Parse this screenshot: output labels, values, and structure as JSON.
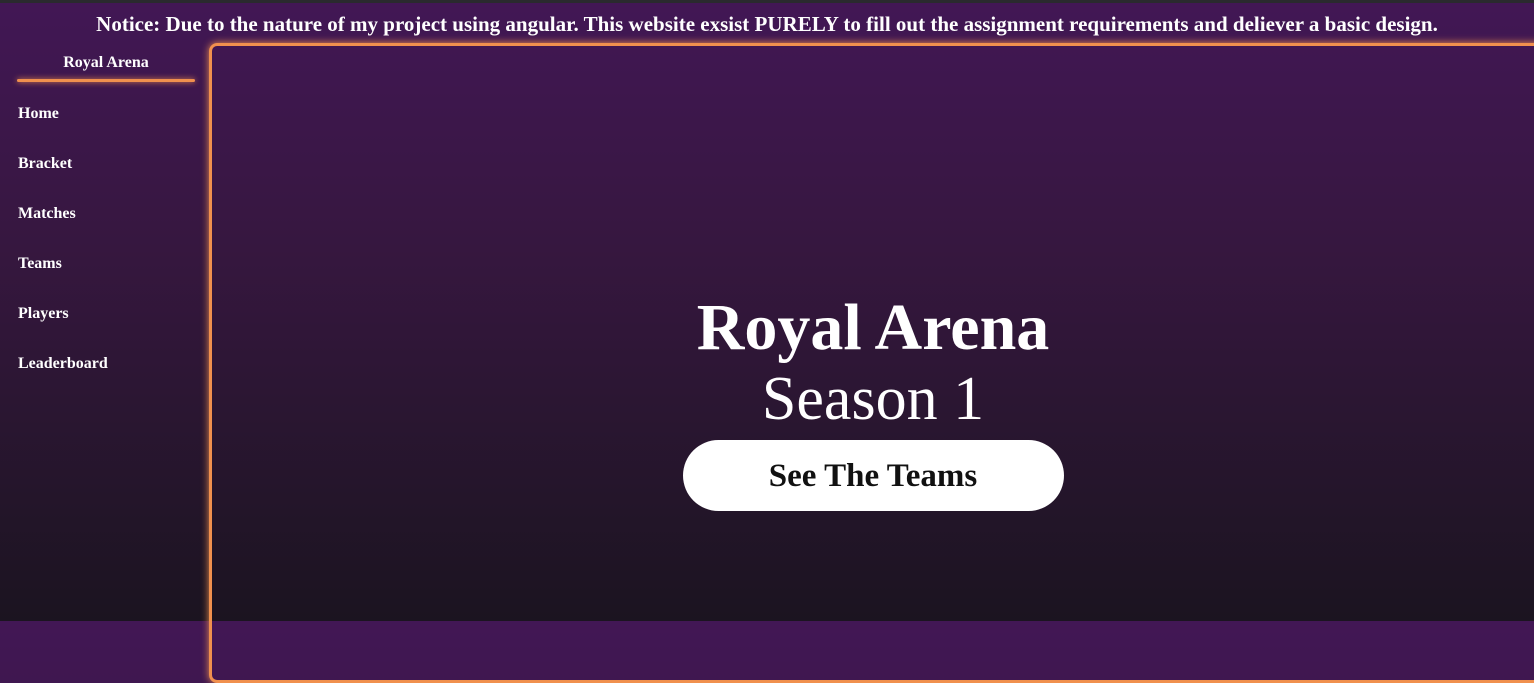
{
  "notice": "Notice: Due to the nature of my project using angular. This website exsist PURELY to fill out the assignment requirements and deliever a basic design.",
  "sidebar": {
    "brand": "Royal Arena",
    "items": [
      {
        "label": "Home"
      },
      {
        "label": "Bracket"
      },
      {
        "label": "Matches"
      },
      {
        "label": "Teams"
      },
      {
        "label": "Players"
      },
      {
        "label": "Leaderboard"
      }
    ]
  },
  "hero": {
    "title": "Royal Arena",
    "subtitle": "Season 1",
    "button": "See The Teams"
  },
  "colors": {
    "accent": "#f0904e",
    "bg_top": "#421755",
    "bg_bottom": "#1b1420"
  }
}
